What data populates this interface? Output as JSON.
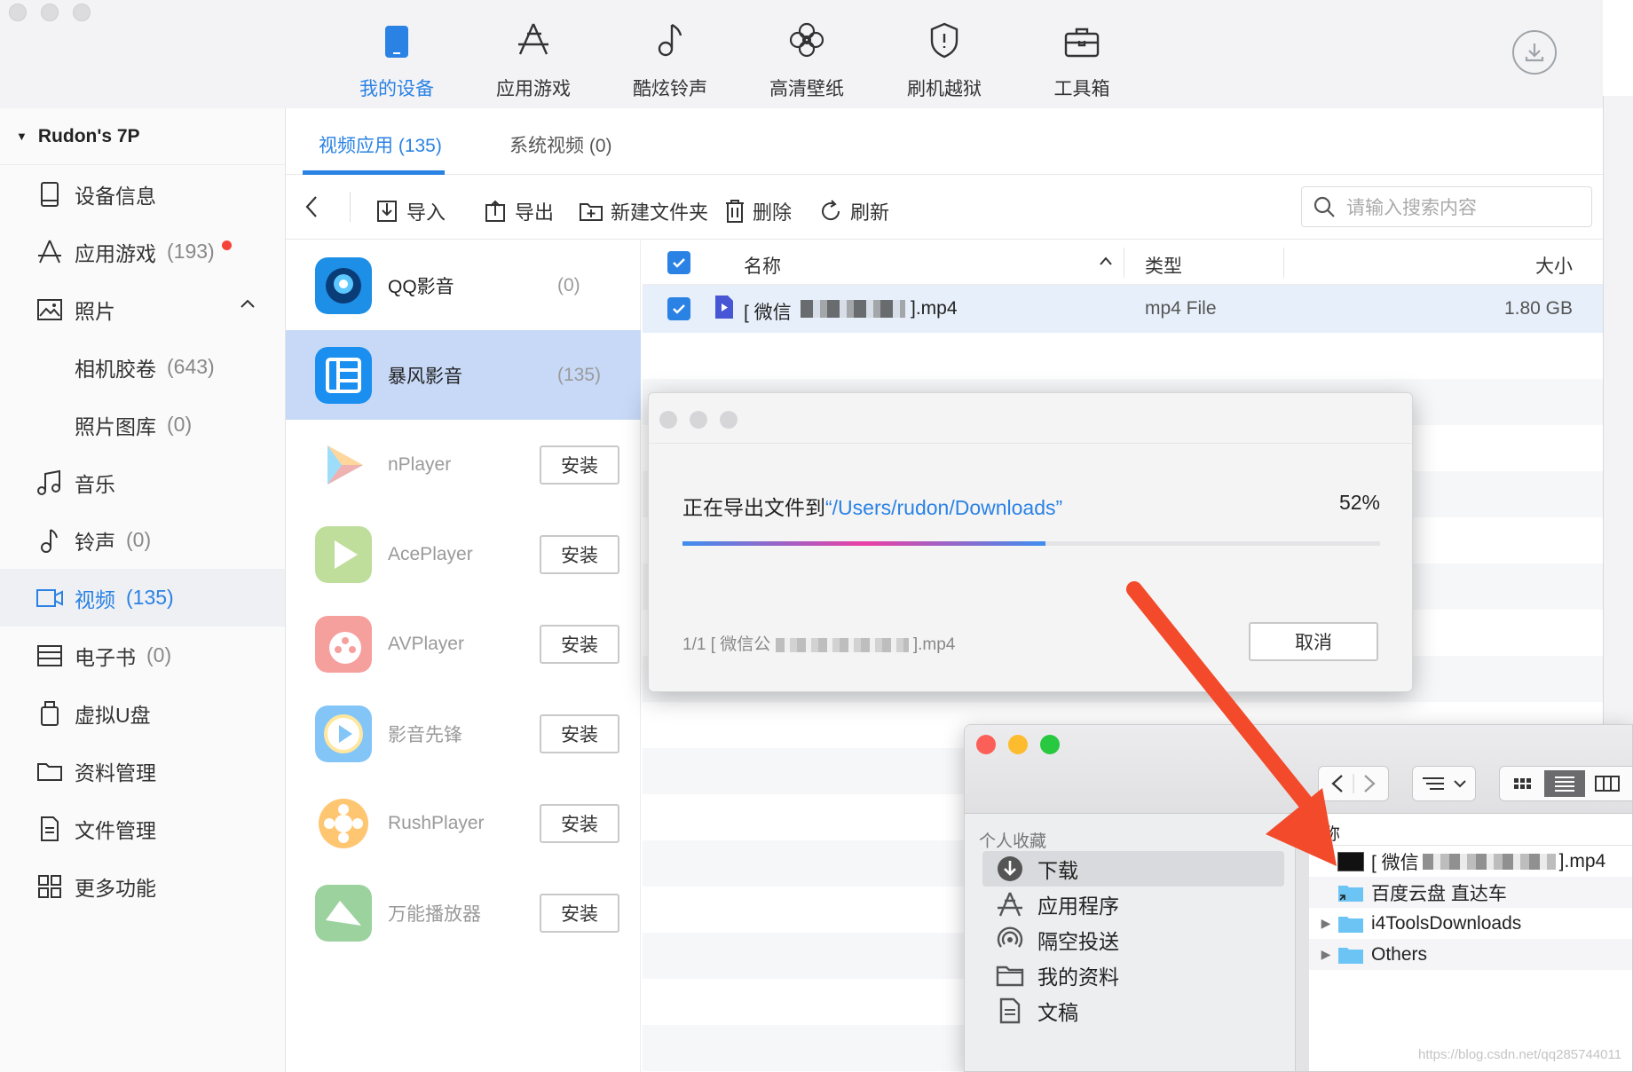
{
  "nav": {
    "items": [
      {
        "label": "我的设备",
        "icon": "phone-icon",
        "active": true
      },
      {
        "label": "应用游戏",
        "icon": "app-store-icon"
      },
      {
        "label": "酷炫铃声",
        "icon": "music-note-icon"
      },
      {
        "label": "高清壁纸",
        "icon": "flower-icon"
      },
      {
        "label": "刷机越狱",
        "icon": "shield-icon"
      },
      {
        "label": "工具箱",
        "icon": "toolbox-icon"
      }
    ],
    "download_icon": "download-icon"
  },
  "sidebar": {
    "device_name": "Rudon's 7P",
    "items": [
      {
        "label": "设备信息",
        "count": "",
        "icon": "device-info-icon"
      },
      {
        "label": "应用游戏",
        "count": "(193)",
        "icon": "app-store-icon",
        "badge": true
      },
      {
        "label": "照片",
        "count": "",
        "icon": "photo-icon",
        "expanded": true
      },
      {
        "label": "相机胶卷",
        "count": "(643)",
        "sub": true
      },
      {
        "label": "照片图库",
        "count": "(0)",
        "sub": true
      },
      {
        "label": "音乐",
        "count": "",
        "icon": "music-icon"
      },
      {
        "label": "铃声",
        "count": "(0)",
        "icon": "ringtone-icon"
      },
      {
        "label": "视频",
        "count": "(135)",
        "icon": "video-icon",
        "active": true
      },
      {
        "label": "电子书",
        "count": "(0)",
        "icon": "ebook-icon"
      },
      {
        "label": "虚拟U盘",
        "count": "",
        "icon": "usb-drive-icon"
      },
      {
        "label": "资料管理",
        "count": "",
        "icon": "folder-icon"
      },
      {
        "label": "文件管理",
        "count": "",
        "icon": "file-icon"
      },
      {
        "label": "更多功能",
        "count": "",
        "icon": "grid-icon"
      }
    ]
  },
  "tabs": [
    {
      "label": "视频应用 (135)",
      "active": true
    },
    {
      "label": "系统视频 (0)"
    }
  ],
  "toolbar": {
    "back_icon": "back-arrow-icon",
    "import_label": "导入",
    "export_label": "导出",
    "new_folder_label": "新建文件夹",
    "delete_label": "删除",
    "refresh_label": "刷新",
    "search_placeholder": "请输入搜索内容"
  },
  "apps": [
    {
      "name": "QQ影音",
      "count": "(0)",
      "installed": true
    },
    {
      "name": "暴风影音",
      "count": "(135)",
      "installed": true,
      "active": true
    },
    {
      "name": "nPlayer",
      "button": "安装"
    },
    {
      "name": "AcePlayer",
      "button": "安装"
    },
    {
      "name": "AVPlayer",
      "button": "安装"
    },
    {
      "name": "影音先锋",
      "button": "安装"
    },
    {
      "name": "RushPlayer",
      "button": "安装"
    },
    {
      "name": "万能播放器",
      "button": "安装"
    }
  ],
  "file_table": {
    "columns": [
      "名称",
      "类型",
      "大小"
    ],
    "rows": [
      {
        "name": "[ 微信",
        "name_suffix": "].mp4",
        "type": "mp4 File",
        "size": "1.80 GB",
        "checked": true
      }
    ]
  },
  "export_dialog": {
    "message_prefix": "正在导出文件到",
    "path": "“/Users/rudon/Downloads”",
    "percent": "52%",
    "progress": 0.52,
    "file_prefix": "1/1  [ 微信公",
    "file_suffix": "].mp4",
    "cancel_label": "取消"
  },
  "finder": {
    "sidebar_section": "个人收藏",
    "sidebar_items": [
      {
        "label": "下载",
        "icon": "download-circle-icon",
        "active": true
      },
      {
        "label": "应用程序",
        "icon": "applications-icon"
      },
      {
        "label": "隔空投送",
        "icon": "airdrop-icon"
      },
      {
        "label": "我的资料",
        "icon": "folder-icon"
      },
      {
        "label": "文稿",
        "icon": "document-icon"
      }
    ],
    "list_header": "称",
    "list_rows": [
      {
        "name": "[ 微信",
        "suffix": "].mp4",
        "kind": "video"
      },
      {
        "name": "百度云盘 直达车",
        "kind": "alias-folder"
      },
      {
        "name": "i4ToolsDownloads",
        "kind": "folder",
        "disclosure": true
      },
      {
        "name": "Others",
        "kind": "folder",
        "disclosure": true
      }
    ]
  },
  "watermark": "https://blog.csdn.net/qq285744011",
  "colors": {
    "accent": "#2a82e4",
    "arrow": "#f24a2a"
  }
}
